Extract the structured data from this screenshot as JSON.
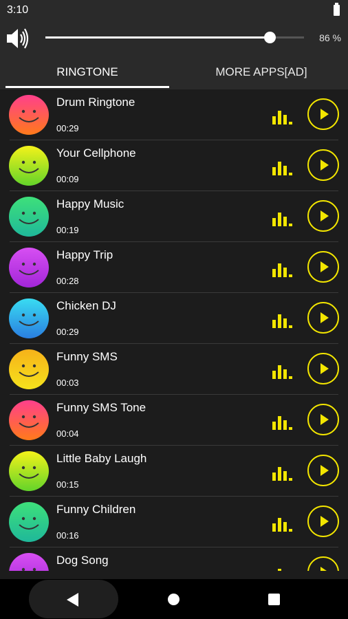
{
  "status": {
    "time": "3:10",
    "battery_icon": "battery-full-icon"
  },
  "volume": {
    "icon": "speaker-icon",
    "level_fraction": 0.86,
    "percent_label": "86 %"
  },
  "tabs": [
    {
      "label": "RINGTONE",
      "active": true
    },
    {
      "label": "MORE APPS[AD]",
      "active": false
    }
  ],
  "accent_color": "#f3e600",
  "ringtones": [
    {
      "title": "Drum Ringtone",
      "duration": "00:29",
      "face_color": "pink-orange"
    },
    {
      "title": "Your Cellphone",
      "duration": "00:09",
      "face_color": "yellow-green"
    },
    {
      "title": "Happy Music",
      "duration": "00:19",
      "face_color": "green-teal"
    },
    {
      "title": "Happy Trip",
      "duration": "00:28",
      "face_color": "purple"
    },
    {
      "title": "Chicken DJ",
      "duration": "00:29",
      "face_color": "cyan-blue"
    },
    {
      "title": "Funny SMS",
      "duration": "00:03",
      "face_color": "orange-yellow"
    },
    {
      "title": "Funny SMS Tone",
      "duration": "00:04",
      "face_color": "pink-orange"
    },
    {
      "title": "Little Baby Laugh",
      "duration": "00:15",
      "face_color": "yellow-green"
    },
    {
      "title": "Funny Children",
      "duration": "00:16",
      "face_color": "green-teal"
    },
    {
      "title": "Dog Song",
      "duration": "",
      "face_color": "purple"
    }
  ],
  "nav": {
    "back_icon": "back-triangle-icon",
    "home_icon": "home-circle-icon",
    "recents_icon": "recents-square-icon"
  }
}
